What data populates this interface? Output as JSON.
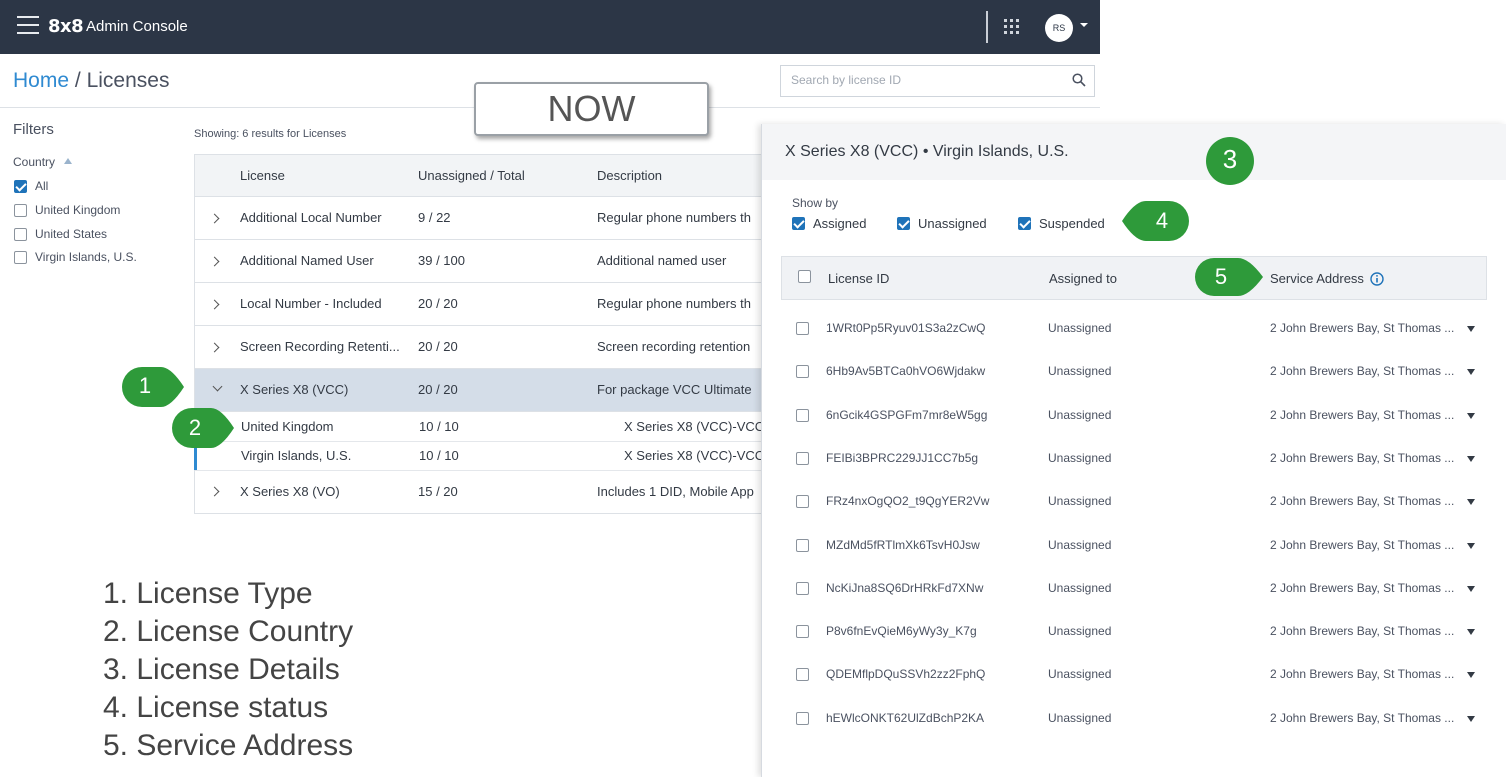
{
  "app": {
    "brand": "8x8",
    "product": "Admin Console",
    "user_initials": "RS"
  },
  "breadcrumb": {
    "home": "Home",
    "separator": "/",
    "current": "Licenses"
  },
  "search": {
    "placeholder": "Search by license ID",
    "value": ""
  },
  "callout": "NOW",
  "filters": {
    "title": "Filters",
    "country_label": "Country",
    "items": [
      {
        "label": "All",
        "checked": true
      },
      {
        "label": "United Kingdom",
        "checked": false
      },
      {
        "label": "United States",
        "checked": false
      },
      {
        "label": "Virgin Islands, U.S.",
        "checked": false
      }
    ]
  },
  "results_text": "Showing: 6 results for Licenses",
  "licenses": {
    "headers": {
      "license": "License",
      "count": "Unassigned / Total",
      "description": "Description"
    },
    "rows": [
      {
        "license": "Additional Local Number",
        "count": "9 / 22",
        "description": "Regular phone numbers th"
      },
      {
        "license": "Additional Named User",
        "count": "39 / 100",
        "description": "Additional named user"
      },
      {
        "license": "Local Number - Included",
        "count": "20 / 20",
        "description": "Regular phone numbers th"
      },
      {
        "license": "Screen Recording Retenti...",
        "count": "20 / 20",
        "description": "Screen recording retention"
      },
      {
        "license": "X Series X8 (VCC)",
        "count": "20 / 20",
        "description": "For package VCC Ultimate",
        "expanded": true
      },
      {
        "license": "X Series X8 (VO)",
        "count": "15 / 20",
        "description": "Includes 1 DID, Mobile App"
      }
    ],
    "subrows": [
      {
        "country": "United Kingdom",
        "count": "10 / 10",
        "description": "X Series X8 (VCC)-VCC"
      },
      {
        "country": "Virgin Islands, U.S.",
        "count": "10 / 10",
        "description": "X Series X8 (VCC)-VCC"
      }
    ]
  },
  "panel": {
    "title": "X Series X8 (VCC) • Virgin Islands, U.S.",
    "show_by_label": "Show by",
    "statuses": [
      {
        "label": "Assigned",
        "checked": true
      },
      {
        "label": "Unassigned",
        "checked": true
      },
      {
        "label": "Suspended",
        "checked": true
      }
    ],
    "headers": {
      "license_id": "License ID",
      "assigned_to": "Assigned to",
      "service_address": "Service Address"
    },
    "rows": [
      {
        "id": "1WRt0Pp5Ryuv01S3a2zCwQ",
        "assigned": "Unassigned",
        "address": "2 John Brewers Bay, St Thomas ..."
      },
      {
        "id": "6Hb9Av5BTCa0hVO6Wjdakw",
        "assigned": "Unassigned",
        "address": "2 John Brewers Bay, St Thomas ..."
      },
      {
        "id": "6nGcik4GSPGFm7mr8eW5gg",
        "assigned": "Unassigned",
        "address": "2 John Brewers Bay, St Thomas ..."
      },
      {
        "id": "FEIBi3BPRC229JJ1CC7b5g",
        "assigned": "Unassigned",
        "address": "2 John Brewers Bay, St Thomas ..."
      },
      {
        "id": "FRz4nxOgQO2_t9QgYER2Vw",
        "assigned": "Unassigned",
        "address": "2 John Brewers Bay, St Thomas ..."
      },
      {
        "id": "MZdMd5fRTlmXk6TsvH0Jsw",
        "assigned": "Unassigned",
        "address": "2 John Brewers Bay, St Thomas ..."
      },
      {
        "id": "NcKiJna8SQ6DrHRkFd7XNw",
        "assigned": "Unassigned",
        "address": "2 John Brewers Bay, St Thomas ..."
      },
      {
        "id": "P8v6fnEvQieM6yWy3y_K7g",
        "assigned": "Unassigned",
        "address": "2 John Brewers Bay, St Thomas ..."
      },
      {
        "id": "QDEMflpDQuSSVh2zz2FphQ",
        "assigned": "Unassigned",
        "address": "2 John Brewers Bay, St Thomas ..."
      },
      {
        "id": "hEWlcONKT62UlZdBchP2KA",
        "assigned": "Unassigned",
        "address": "2 John Brewers Bay, St Thomas ..."
      }
    ]
  },
  "markers": [
    "1",
    "2",
    "3",
    "4",
    "5"
  ],
  "legend": [
    "1. License Type",
    "2. License Country",
    "3. License Details",
    "4. License status",
    "5. Service Address"
  ],
  "colors": {
    "topbar": "#2c3646",
    "accent": "#2f8ad1",
    "checkbox": "#1f73b9",
    "marker": "#2e9a3a",
    "selected_row": "#d4dde8"
  },
  "icons": [
    "hamburger-icon",
    "apps-grid-icon",
    "chevron-down-icon",
    "search-icon",
    "chevron-right-icon",
    "info-icon",
    "caret-down-icon"
  ]
}
